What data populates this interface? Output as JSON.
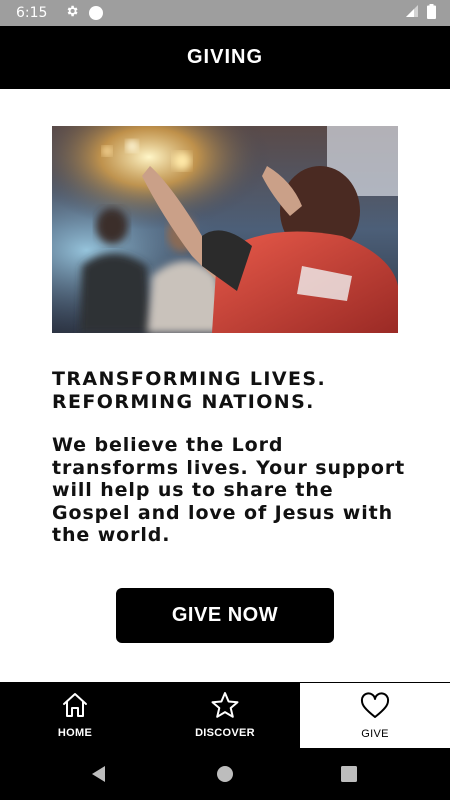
{
  "status_bar": {
    "time": "6:15",
    "icons": [
      "gear-icon",
      "circle-icon",
      "signal-icon",
      "battery-icon"
    ]
  },
  "app_bar": {
    "title": "GIVING"
  },
  "hero": {
    "icon": "worship-photo"
  },
  "content": {
    "headline": "TRANSFORMING LIVES. REFORMING NATIONS.",
    "body": "We believe the Lord transforms lives. Your support will help us to share the Gospel and love of Jesus with the world."
  },
  "give_button": {
    "label": "GIVE NOW"
  },
  "bottom_nav": {
    "items": [
      {
        "label": "HOME",
        "icon": "home-icon",
        "active": false
      },
      {
        "label": "DISCOVER",
        "icon": "star-icon",
        "active": false
      },
      {
        "label": "GIVE",
        "icon": "heart-icon",
        "active": true
      }
    ]
  },
  "system_nav": {
    "icons": [
      "back-icon",
      "home-circle-icon",
      "recents-icon"
    ]
  },
  "colors": {
    "primary": "#000000",
    "background": "#ffffff",
    "status_bar": "#9e9e9e"
  }
}
